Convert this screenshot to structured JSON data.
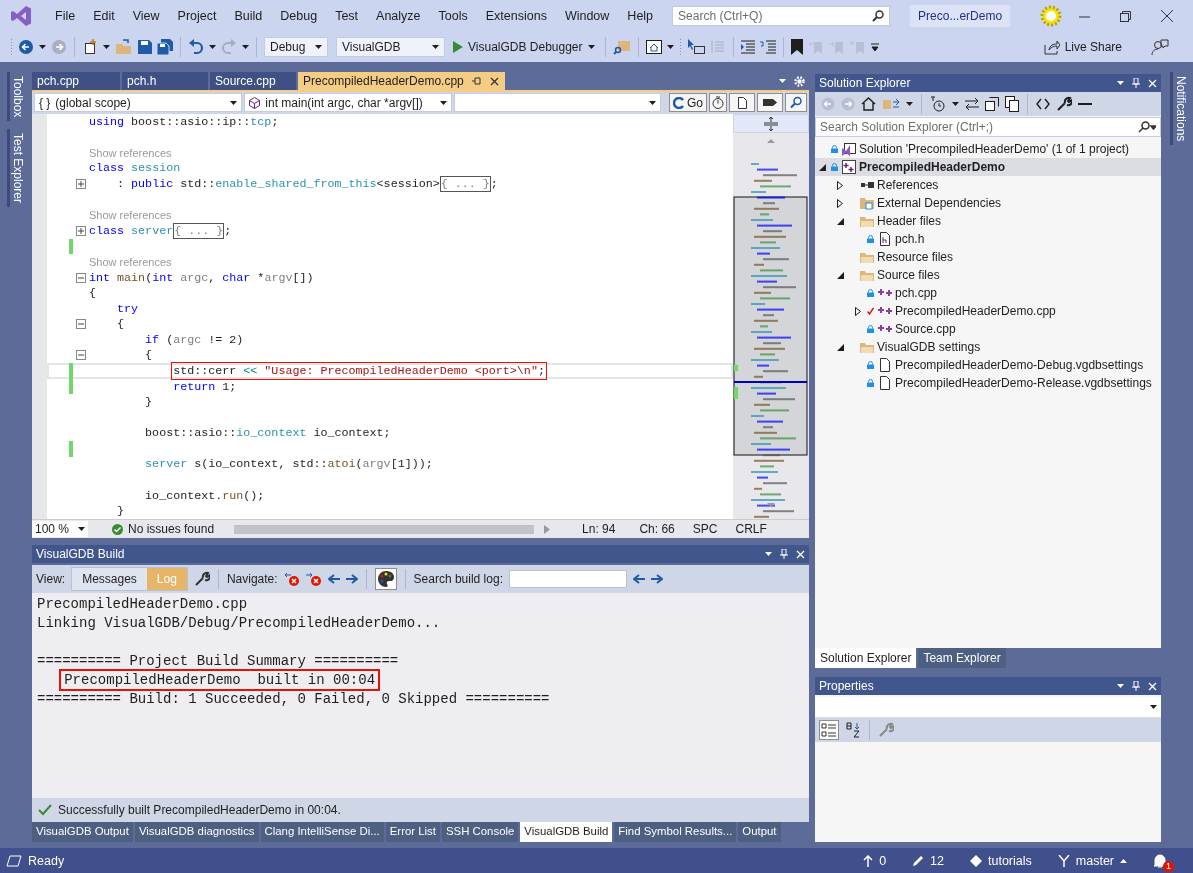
{
  "menubar": {
    "items": [
      "File",
      "Edit",
      "View",
      "Project",
      "Build",
      "Debug",
      "Test",
      "Analyze",
      "Tools",
      "Extensions",
      "Window",
      "Help"
    ],
    "search": {
      "placeholder": "Search (Ctrl+Q)"
    },
    "solution_badge": "Preco...erDemo"
  },
  "toolbar": {
    "configuration": "Debug",
    "platform": "VisualGDB",
    "debugger": "VisualGDB Debugger",
    "live_share": "Live Share"
  },
  "left_side_tabs": [
    "Toolbox",
    "Test Explorer"
  ],
  "right_side_tabs": [
    "Notifications"
  ],
  "editor": {
    "tabs": [
      {
        "label": "pch.cpp",
        "selected": false
      },
      {
        "label": "pch.h",
        "selected": false
      },
      {
        "label": "Source.cpp",
        "selected": false
      },
      {
        "label": "PrecompiledHeaderDemo.cpp",
        "selected": true
      }
    ],
    "scope_glyph": "{ }",
    "scope": "(global scope)",
    "member": "int main(int argc, char *argv[])",
    "go": "Go",
    "lines": [
      {
        "kind": "code",
        "foldable": false,
        "changed": false,
        "current": false,
        "boxed": false,
        "tokens": [
          {
            "kind": "kw",
            "text": "using"
          },
          {
            "kind": "plain",
            "text": " boost::asio::ip::"
          },
          {
            "kind": "type",
            "text": "tcp"
          },
          {
            "kind": "plain",
            "text": ";"
          }
        ]
      },
      {
        "kind": "blank",
        "foldable": false,
        "changed": false,
        "current": false
      },
      {
        "kind": "lens",
        "foldable": false,
        "changed": false,
        "current": false,
        "text": "Show references"
      },
      {
        "kind": "code",
        "foldable": false,
        "changed": false,
        "current": false,
        "boxed": false,
        "tokens": [
          {
            "kind": "kw",
            "text": "class "
          },
          {
            "kind": "type",
            "text": "session"
          }
        ]
      },
      {
        "kind": "code",
        "foldable": true,
        "folded": true,
        "changed": false,
        "current": false,
        "boxed": false,
        "tokens": [
          {
            "kind": "plain",
            "text": "    : "
          },
          {
            "kind": "kw",
            "text": "public"
          },
          {
            "kind": "plain",
            "text": " std::"
          },
          {
            "kind": "type",
            "text": "enable_shared_from_this"
          },
          {
            "kind": "plain",
            "text": "<session>"
          },
          {
            "kind": "fold",
            "text": "{ ... }"
          },
          {
            "kind": "plain",
            "text": ";"
          }
        ]
      },
      {
        "kind": "blank",
        "foldable": false,
        "changed": false,
        "current": false
      },
      {
        "kind": "lens",
        "foldable": false,
        "changed": false,
        "current": false,
        "text": "Show references"
      },
      {
        "kind": "code",
        "foldable": true,
        "folded": true,
        "changed": false,
        "current": false,
        "boxed": false,
        "tokens": [
          {
            "kind": "kw",
            "text": "class "
          },
          {
            "kind": "type",
            "text": "server"
          },
          {
            "kind": "fold",
            "text": "{ ... }"
          },
          {
            "kind": "plain",
            "text": ";"
          }
        ]
      },
      {
        "kind": "blank",
        "foldable": false,
        "changed": true,
        "current": false
      },
      {
        "kind": "lens",
        "foldable": false,
        "changed": false,
        "current": false,
        "text": "Show references"
      },
      {
        "kind": "code",
        "foldable": true,
        "folded": false,
        "changed": false,
        "current": false,
        "boxed": false,
        "tokens": [
          {
            "kind": "kw",
            "text": "int "
          },
          {
            "kind": "fn",
            "text": "main"
          },
          {
            "kind": "plain",
            "text": "("
          },
          {
            "kind": "kw",
            "text": "int "
          },
          {
            "kind": "param",
            "text": "argc"
          },
          {
            "kind": "plain",
            "text": ", "
          },
          {
            "kind": "kw",
            "text": "char"
          },
          {
            "kind": "plain",
            "text": " *"
          },
          {
            "kind": "param",
            "text": "argv"
          },
          {
            "kind": "plain",
            "text": "[])"
          }
        ]
      },
      {
        "kind": "code",
        "foldable": false,
        "changed": false,
        "current": false,
        "boxed": false,
        "tokens": [
          {
            "kind": "plain",
            "text": "{"
          }
        ]
      },
      {
        "kind": "code",
        "foldable": false,
        "changed": false,
        "current": false,
        "boxed": false,
        "tokens": [
          {
            "kind": "kw",
            "text": "    try"
          }
        ]
      },
      {
        "kind": "code",
        "foldable": true,
        "folded": false,
        "changed": false,
        "current": false,
        "boxed": false,
        "tokens": [
          {
            "kind": "plain",
            "text": "    {"
          }
        ]
      },
      {
        "kind": "code",
        "foldable": false,
        "changed": false,
        "current": false,
        "boxed": false,
        "tokens": [
          {
            "kind": "kw",
            "text": "        if"
          },
          {
            "kind": "plain",
            "text": " ("
          },
          {
            "kind": "param",
            "text": "argc"
          },
          {
            "kind": "plain",
            "text": " != 2)"
          }
        ]
      },
      {
        "kind": "code",
        "foldable": true,
        "folded": false,
        "changed": false,
        "current": false,
        "boxed": false,
        "tokens": [
          {
            "kind": "plain",
            "text": "        {"
          }
        ]
      },
      {
        "kind": "code",
        "foldable": false,
        "changed": true,
        "current": true,
        "boxed": true,
        "tokens": [
          {
            "kind": "plain",
            "text": "            std::cerr "
          },
          {
            "kind": "op",
            "text": "<<"
          },
          {
            "kind": "str",
            "text": " \"Usage: PrecompiledHeaderDemo <port>\\n\""
          },
          {
            "kind": "plain",
            "text": ";"
          }
        ]
      },
      {
        "kind": "code",
        "foldable": false,
        "changed": true,
        "current": false,
        "boxed": false,
        "tokens": [
          {
            "kind": "kw",
            "text": "            return"
          },
          {
            "kind": "plain",
            "text": " 1;"
          }
        ]
      },
      {
        "kind": "code",
        "foldable": false,
        "changed": false,
        "current": false,
        "boxed": false,
        "tokens": [
          {
            "kind": "plain",
            "text": "        }"
          }
        ]
      },
      {
        "kind": "blank",
        "foldable": false,
        "changed": false,
        "current": false
      },
      {
        "kind": "code",
        "foldable": false,
        "changed": false,
        "current": false,
        "boxed": false,
        "tokens": [
          {
            "kind": "plain",
            "text": "        boost::asio::"
          },
          {
            "kind": "type",
            "text": "io_context"
          },
          {
            "kind": "plain",
            "text": " io_context;"
          }
        ]
      },
      {
        "kind": "blank",
        "foldable": false,
        "changed": true,
        "current": false
      },
      {
        "kind": "code",
        "foldable": false,
        "changed": false,
        "current": false,
        "boxed": false,
        "tokens": [
          {
            "kind": "type",
            "text": "        server"
          },
          {
            "kind": "plain",
            "text": " s(io_context, std::"
          },
          {
            "kind": "fn",
            "text": "atoi"
          },
          {
            "kind": "plain",
            "text": "("
          },
          {
            "kind": "param",
            "text": "argv"
          },
          {
            "kind": "plain",
            "text": "[1]));"
          }
        ]
      },
      {
        "kind": "blank",
        "foldable": false,
        "changed": false,
        "current": false
      },
      {
        "kind": "code",
        "foldable": false,
        "changed": false,
        "current": false,
        "boxed": false,
        "tokens": [
          {
            "kind": "plain",
            "text": "        io_context."
          },
          {
            "kind": "fn",
            "text": "run"
          },
          {
            "kind": "plain",
            "text": "();"
          }
        ]
      },
      {
        "kind": "code",
        "foldable": false,
        "changed": false,
        "current": false,
        "boxed": false,
        "tokens": [
          {
            "kind": "plain",
            "text": "    }"
          }
        ]
      }
    ],
    "zoom": "100 %",
    "issues": "No issues found",
    "line": "Ln: 94",
    "column": "Ch: 66",
    "indent": "SPC",
    "line_ending": "CRLF"
  },
  "build_panel": {
    "title": "VisualGDB Build",
    "view_label": "View:",
    "views": [
      {
        "label": "Messages",
        "selected": false
      },
      {
        "label": "Log",
        "selected": true
      }
    ],
    "navigate_label": "Navigate:",
    "search_label": "Search build log:",
    "log": [
      {
        "text": "PrecompiledHeaderDemo.cpp",
        "boxed": false
      },
      {
        "text": "Linking VisualGDB/Debug/PrecompiledHeaderDemo...",
        "boxed": false
      },
      {
        "kind": "blank"
      },
      {
        "text": "========== Project Build Summary ==========",
        "boxed": false
      },
      {
        "text": "    PrecompiledHeaderDemo  built in 00:04",
        "boxed": true
      },
      {
        "text": "========== Build: 1 Succeeded, 0 Failed, 0 Skipped ==========",
        "boxed": false
      }
    ],
    "status": "Successfully built PrecompiledHeaderDemo in 00:04."
  },
  "bottom_tabs": [
    {
      "label": "VisualGDB Output",
      "selected": false
    },
    {
      "label": "VisualGDB diagnostics",
      "selected": false
    },
    {
      "label": "Clang IntelliSense Di...",
      "selected": false
    },
    {
      "label": "Error List",
      "selected": false
    },
    {
      "label": "SSH Console",
      "selected": false
    },
    {
      "label": "VisualGDB Build",
      "selected": true
    },
    {
      "label": "Find Symbol Results...",
      "selected": false
    },
    {
      "label": "Output",
      "selected": false
    }
  ],
  "solution_explorer": {
    "title": "Solution Explorer",
    "search": {
      "placeholder": "Search Solution Explorer (Ctrl+;)"
    },
    "tree": [
      {
        "label": "Solution 'PrecompiledHeaderDemo' (1 of 1 project)",
        "kind": "solution",
        "expandable": false,
        "locked": true,
        "selected": false,
        "children": [
          {
            "label": "PrecompiledHeaderDemo",
            "kind": "project",
            "expandable": true,
            "expanded": true,
            "locked": true,
            "selected": true,
            "children": [
              {
                "label": "References",
                "kind": "references",
                "expandable": true,
                "expanded": false,
                "locked": false,
                "selected": false
              },
              {
                "label": "External Dependencies",
                "kind": "external",
                "expandable": true,
                "expanded": false,
                "locked": false,
                "selected": false
              },
              {
                "label": "Header files",
                "kind": "folder",
                "expandable": true,
                "expanded": true,
                "locked": false,
                "selected": false,
                "children": [
                  {
                    "label": "pch.h",
                    "kind": "header",
                    "expandable": false,
                    "locked": true,
                    "selected": false
                  }
                ]
              },
              {
                "label": "Resource files",
                "kind": "folder",
                "expandable": false,
                "locked": false,
                "selected": false
              },
              {
                "label": "Source files",
                "kind": "folder",
                "expandable": true,
                "expanded": true,
                "locked": false,
                "selected": false,
                "children": [
                  {
                    "label": "pch.cpp",
                    "kind": "cpp",
                    "expandable": false,
                    "locked": true,
                    "selected": false
                  },
                  {
                    "label": "PrecompiledHeaderDemo.cpp",
                    "kind": "cpp",
                    "expandable": true,
                    "expanded": false,
                    "modified": true,
                    "selected": false
                  },
                  {
                    "label": "Source.cpp",
                    "kind": "cpp",
                    "expandable": false,
                    "locked": true,
                    "selected": false
                  }
                ]
              },
              {
                "label": "VisualGDB settings",
                "kind": "folder",
                "expandable": true,
                "expanded": true,
                "locked": false,
                "selected": false,
                "children": [
                  {
                    "label": "PrecompiledHeaderDemo-Debug.vgdbsettings",
                    "kind": "file",
                    "expandable": false,
                    "locked": true,
                    "selected": false
                  },
                  {
                    "label": "PrecompiledHeaderDemo-Release.vgdbsettings",
                    "kind": "file",
                    "expandable": false,
                    "locked": true,
                    "selected": false
                  }
                ]
              }
            ]
          }
        ]
      }
    ],
    "tabs": [
      {
        "label": "Solution Explorer",
        "selected": true
      },
      {
        "label": "Team Explorer",
        "selected": false
      }
    ]
  },
  "properties": {
    "title": "Properties"
  },
  "status_bar": {
    "text": "Ready",
    "pushes": "0",
    "changes": "12",
    "repository": "tutorials",
    "branch": "master",
    "notifications": "1"
  }
}
